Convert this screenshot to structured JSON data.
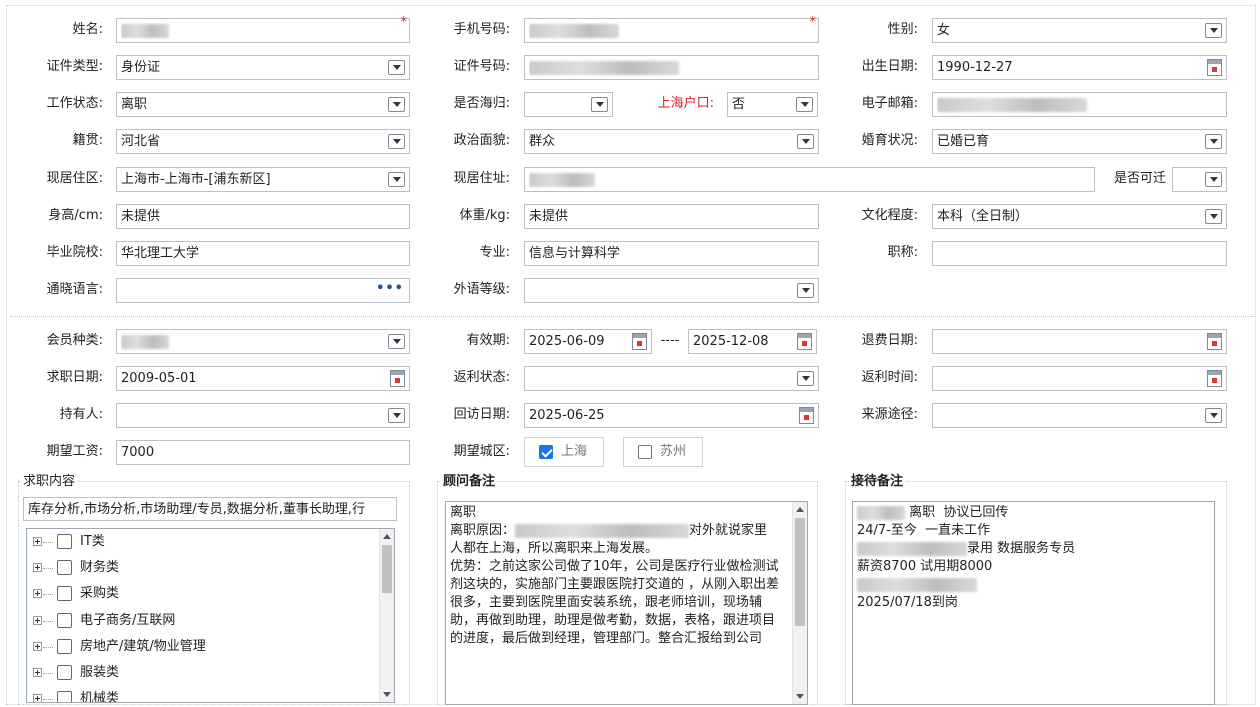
{
  "personal": {
    "name": {
      "label": "姓名:",
      "value": ""
    },
    "mobile": {
      "label": "手机号码:",
      "value": ""
    },
    "gender": {
      "label": "性别:",
      "value": "女"
    },
    "id_type": {
      "label": "证件类型:",
      "value": "身份证"
    },
    "id_number": {
      "label": "证件号码:",
      "value": ""
    },
    "birth_date": {
      "label": "出生日期:",
      "value": "1990-12-27"
    },
    "work_status": {
      "label": "工作状态:",
      "value": "离职"
    },
    "returnee": {
      "label": "是否海归:",
      "value": ""
    },
    "shanghai_hukou": {
      "label": "上海户口:",
      "value": "否"
    },
    "email": {
      "label": "电子邮箱:",
      "value": ""
    },
    "native_place": {
      "label": "籍贯:",
      "value": "河北省"
    },
    "political_status": {
      "label": "政治面貌:",
      "value": "群众"
    },
    "marital_status": {
      "label": "婚育状况:",
      "value": "已婚已育"
    },
    "residence_area": {
      "label": "现居住区:",
      "value": "上海市-上海市-[浦东新区]"
    },
    "residence_address": {
      "label": "现居住址:",
      "value": ""
    },
    "relocatable": {
      "label": "是否可迁",
      "value": ""
    },
    "height": {
      "label": "身高/cm:",
      "value": "未提供"
    },
    "weight": {
      "label": "体重/kg:",
      "value": "未提供"
    },
    "education": {
      "label": "文化程度:",
      "value": "本科（全日制）"
    },
    "school": {
      "label": "毕业院校:",
      "value": "华北理工大学"
    },
    "major": {
      "label": "专业:",
      "value": "信息与计算科学"
    },
    "title": {
      "label": "职称:",
      "value": ""
    },
    "languages": {
      "label": "通晓语言:",
      "value": ""
    },
    "foreign_level": {
      "label": "外语等级:",
      "value": ""
    }
  },
  "membership": {
    "member_type": {
      "label": "会员种类:",
      "value": ""
    },
    "validity": {
      "label": "有效期:",
      "start": "2025-06-09",
      "separator": "----",
      "end": "2025-12-08"
    },
    "refund_date": {
      "label": "退费日期:",
      "value": ""
    },
    "job_seek_date": {
      "label": "求职日期:",
      "value": "2009-05-01"
    },
    "rebate_status": {
      "label": "返利状态:",
      "value": ""
    },
    "rebate_time": {
      "label": "返利时间:",
      "value": ""
    },
    "holder": {
      "label": "持有人:",
      "value": ""
    },
    "revisit_date": {
      "label": "回访日期:",
      "value": "2025-06-25"
    },
    "source": {
      "label": "来源途径:",
      "value": ""
    },
    "expected_salary": {
      "label": "期望工资:",
      "value": "7000"
    },
    "expected_city": {
      "label": "期望城区:",
      "options": [
        {
          "label": "上海",
          "checked": true
        },
        {
          "label": "苏州",
          "checked": false
        }
      ]
    }
  },
  "job_content": {
    "title": "求职内容",
    "summary": "库存分析,市场分析,市场助理/专员,数据分析,董事长助理,行",
    "tree": [
      "IT类",
      "财务类",
      "采购类",
      "电子商务/互联网",
      "房地产/建筑/物业管理",
      "服装类",
      "机械类"
    ]
  },
  "consultant_notes": {
    "title": "顾问备注",
    "lines": [
      "离职",
      "离职原因：",
      "对外就说家里",
      "人都在上海，所以离职来上海发展。",
      "",
      "优势：之前这家公司做了10年，公司是医疗行业做检测试剂这块的，实施部门主要跟医院打交道的 ，从刚入职出差很多，主要到医院里面安装系统，跟老师培训，现场辅助，再做到助理，助理是做考勤，数据，表格，跟进项目的进度，最后做到经理，管理部门。整合汇报给到公司"
    ]
  },
  "reception_notes": {
    "title": "接待备注",
    "lines": [
      "离职  协议已回传",
      "",
      "24/7-至今  一直未工作",
      "",
      "录用 数据服务专员",
      "薪资8700 试用期8000",
      "",
      "2025/07/18到岗"
    ]
  }
}
